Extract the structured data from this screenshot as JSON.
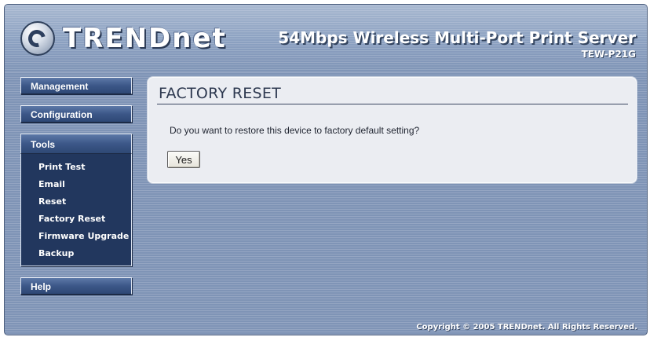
{
  "header": {
    "logo_text": "TRENDnet",
    "logo_icon": "trendnet-logo-icon",
    "product_title": "54Mbps Wireless Multi-Port Print Server",
    "model": "TEW-P21G"
  },
  "sidebar": {
    "management_label": "Management",
    "configuration_label": "Configuration",
    "tools_label": "Tools",
    "tools_items": [
      {
        "label": "Print Test"
      },
      {
        "label": "Email"
      },
      {
        "label": "Reset"
      },
      {
        "label": "Factory Reset"
      },
      {
        "label": "Firmware Upgrade"
      },
      {
        "label": "Backup"
      }
    ],
    "help_label": "Help"
  },
  "content": {
    "title": "FACTORY RESET",
    "question": "Do you want to restore this device to factory default setting?",
    "yes_label": "Yes"
  },
  "footer": {
    "copyright": "Copyright © 2005 TRENDnet. All Rights Reserved."
  },
  "colors": {
    "background": "#7f94b6",
    "nav_button": "#3c5788",
    "tools_panel": "#22375e",
    "content_panel": "#ebedf2"
  }
}
